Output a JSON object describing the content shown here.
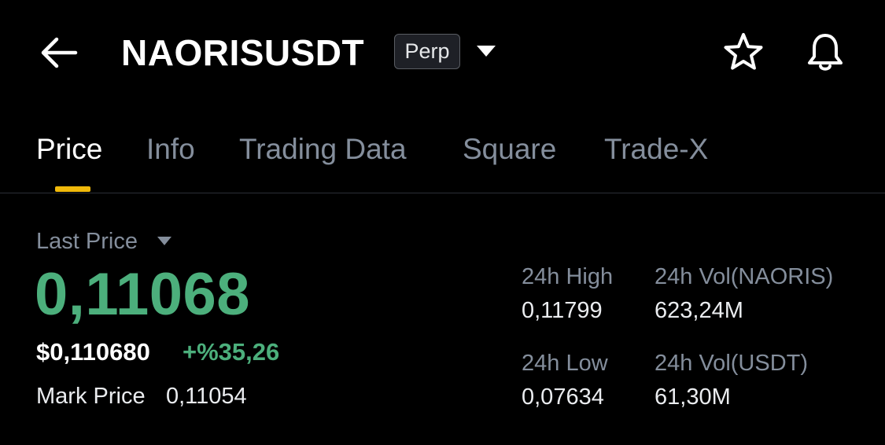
{
  "header": {
    "symbol": "NAORISUSDT",
    "badge": "Perp",
    "icons": [
      "back-arrow-icon",
      "caret-down-icon",
      "star-icon",
      "bell-icon"
    ]
  },
  "tabs": [
    {
      "label": "Price",
      "active": true
    },
    {
      "label": "Info",
      "active": false
    },
    {
      "label": "Trading Data",
      "active": false
    },
    {
      "label": "Square",
      "active": false
    },
    {
      "label": "Trade-X",
      "active": false
    }
  ],
  "price": {
    "last_price_label": "Last Price",
    "last_price": "0,11068",
    "usd_price": "$0,110680",
    "change": "+%35,26",
    "mark_price_label": "Mark Price",
    "mark_price": "0,11054"
  },
  "stats": {
    "high_label": "24h High",
    "high_value": "0,11799",
    "vol_base_label": "24h Vol(NAORIS)",
    "vol_base_value": "623,24M",
    "low_label": "24h Low",
    "low_value": "0,07634",
    "vol_quote_label": "24h Vol(USDT)",
    "vol_quote_value": "61,30M"
  },
  "colors": {
    "background": "#000000",
    "positive": "#4caf7c",
    "accent_tab_indicator": "#f0b90b",
    "muted_text": "#848e9c",
    "primary_text": "#ffffff"
  }
}
